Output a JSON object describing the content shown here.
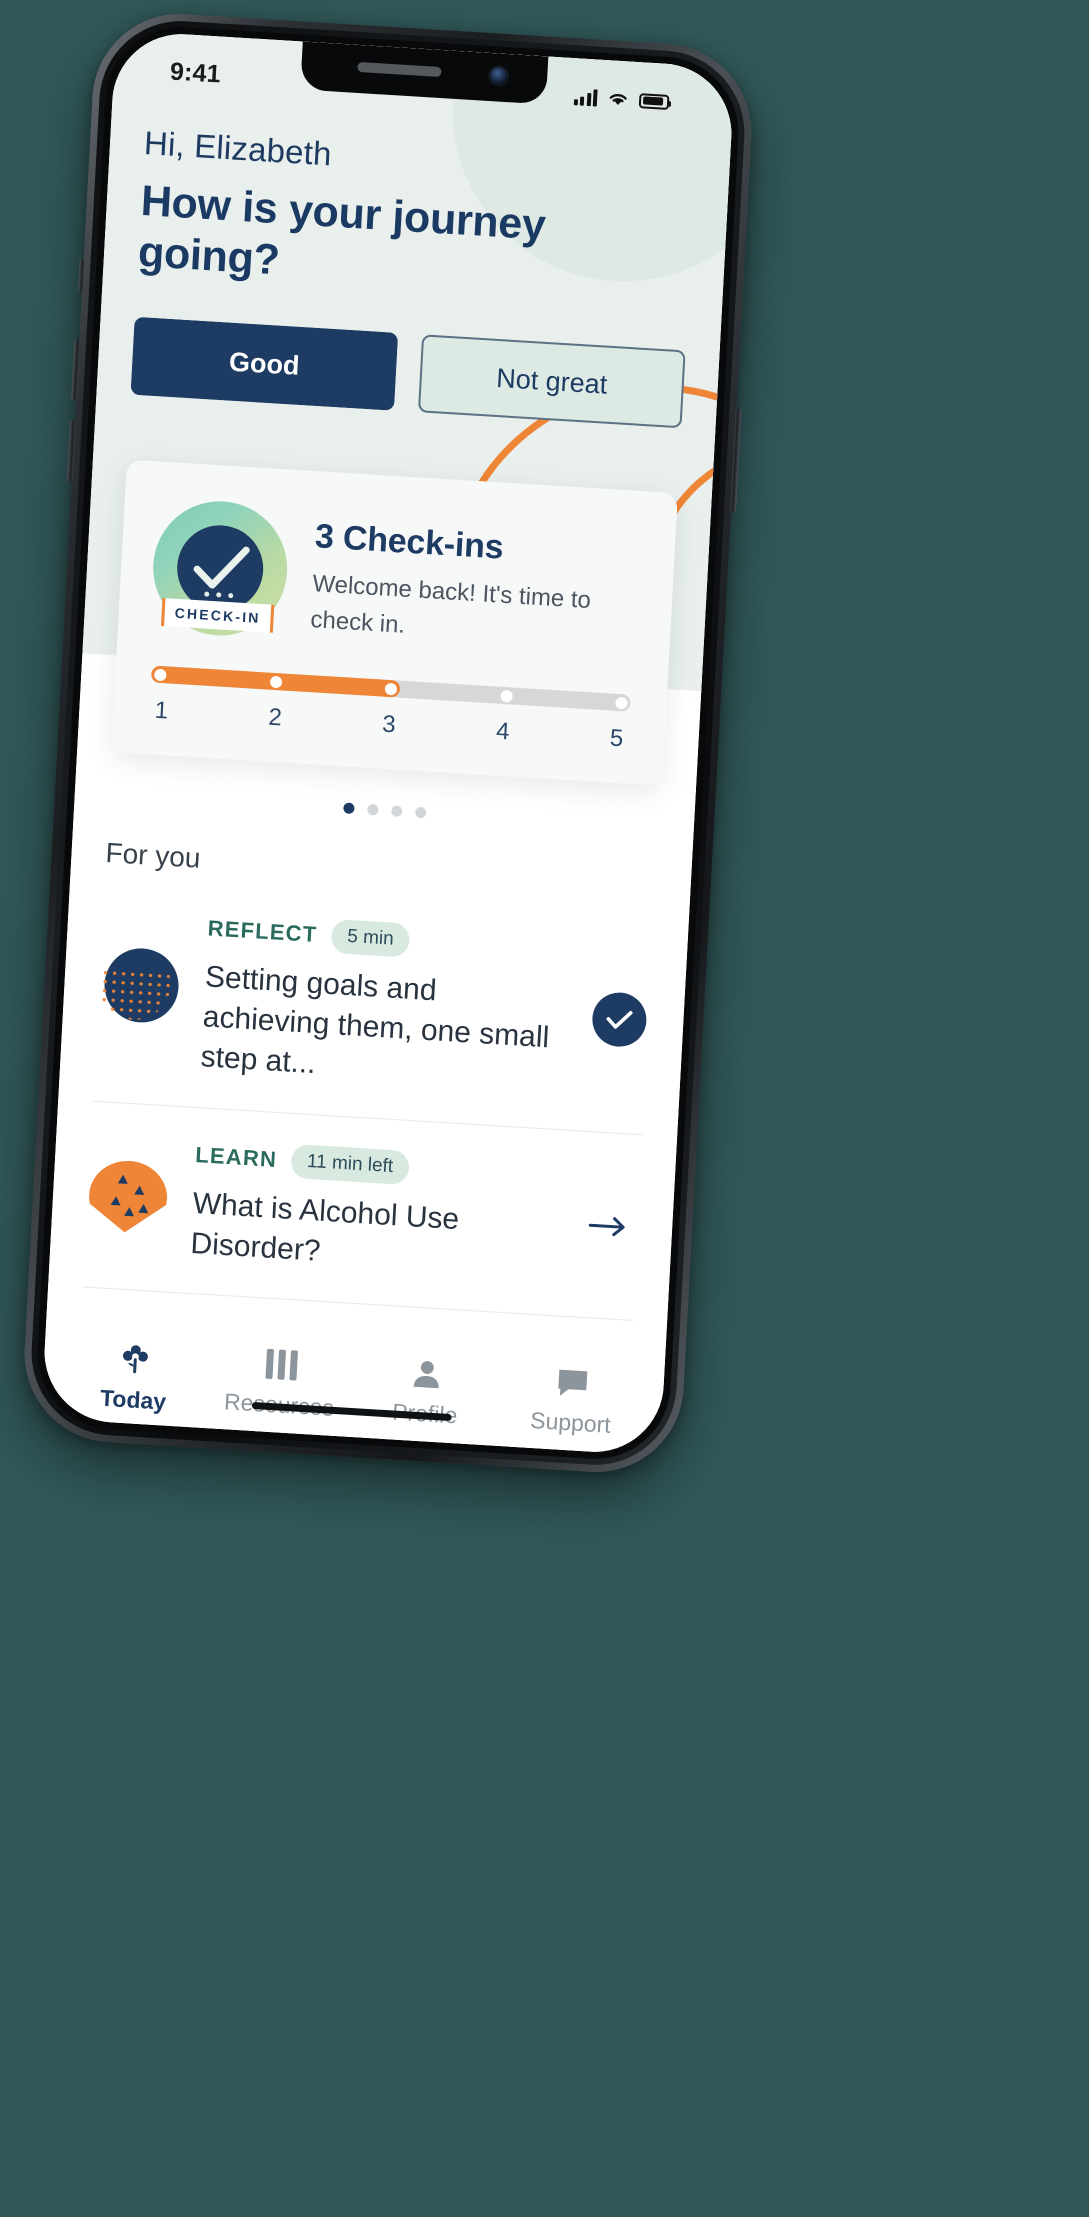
{
  "status_bar": {
    "time": "9:41",
    "signal_icon": "cellular-signal-icon",
    "wifi_icon": "wifi-icon",
    "battery_icon": "battery-icon"
  },
  "hero": {
    "greeting": "Hi, Elizabeth",
    "title": "How is your journey going?",
    "mood_options": [
      {
        "label": "Good",
        "selected": true
      },
      {
        "label": "Not great",
        "selected": false
      }
    ]
  },
  "checkin_card": {
    "badge_ribbon": "CHECK-IN",
    "title": "3 Check-ins",
    "subtitle": "Welcome back! It's time to check in.",
    "progress": {
      "current": 3,
      "total": 5,
      "labels": [
        "1",
        "2",
        "3",
        "4",
        "5"
      ],
      "fill_color": "#ef8536",
      "track_color": "#d7d7d7"
    }
  },
  "pager": {
    "count": 4,
    "active_index": 0
  },
  "for_you": {
    "section_title": "For you",
    "items": [
      {
        "kicker": "REFLECT",
        "chip": "5 min",
        "headline": "Setting goals and achieving them, one small step at...",
        "action": "completed",
        "thumb": "reflect-thumbnail"
      },
      {
        "kicker": "LEARN",
        "chip": "11 min left",
        "headline": "What is Alcohol Use Disorder?",
        "action": "continue",
        "thumb": "learn-thumbnail"
      }
    ]
  },
  "tab_bar": {
    "tabs": [
      {
        "label": "Today",
        "icon": "flower-icon",
        "active": true
      },
      {
        "label": "Resources",
        "icon": "bars-icon",
        "active": false
      },
      {
        "label": "Profile",
        "icon": "person-icon",
        "active": false
      },
      {
        "label": "Support",
        "icon": "chat-bubble-icon",
        "active": false
      }
    ]
  },
  "colors": {
    "navy": "#1d3b63",
    "orange": "#ef8536",
    "mint": "#e8efec",
    "teal_text": "#2a6b5e"
  }
}
